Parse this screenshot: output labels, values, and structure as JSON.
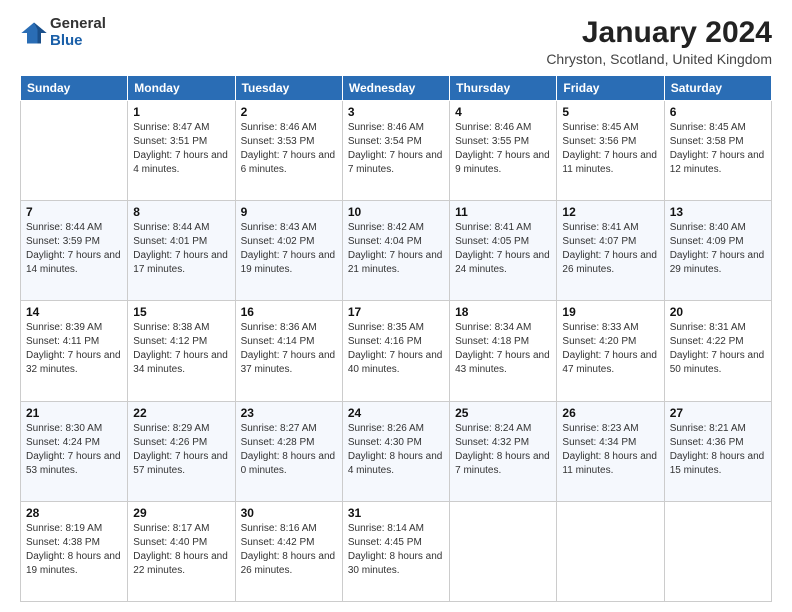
{
  "logo": {
    "general": "General",
    "blue": "Blue"
  },
  "title": "January 2024",
  "location": "Chryston, Scotland, United Kingdom",
  "days_of_week": [
    "Sunday",
    "Monday",
    "Tuesday",
    "Wednesday",
    "Thursday",
    "Friday",
    "Saturday"
  ],
  "weeks": [
    [
      {
        "day": "",
        "sunrise": "",
        "sunset": "",
        "daylight": ""
      },
      {
        "day": "1",
        "sunrise": "Sunrise: 8:47 AM",
        "sunset": "Sunset: 3:51 PM",
        "daylight": "Daylight: 7 hours and 4 minutes."
      },
      {
        "day": "2",
        "sunrise": "Sunrise: 8:46 AM",
        "sunset": "Sunset: 3:53 PM",
        "daylight": "Daylight: 7 hours and 6 minutes."
      },
      {
        "day": "3",
        "sunrise": "Sunrise: 8:46 AM",
        "sunset": "Sunset: 3:54 PM",
        "daylight": "Daylight: 7 hours and 7 minutes."
      },
      {
        "day": "4",
        "sunrise": "Sunrise: 8:46 AM",
        "sunset": "Sunset: 3:55 PM",
        "daylight": "Daylight: 7 hours and 9 minutes."
      },
      {
        "day": "5",
        "sunrise": "Sunrise: 8:45 AM",
        "sunset": "Sunset: 3:56 PM",
        "daylight": "Daylight: 7 hours and 11 minutes."
      },
      {
        "day": "6",
        "sunrise": "Sunrise: 8:45 AM",
        "sunset": "Sunset: 3:58 PM",
        "daylight": "Daylight: 7 hours and 12 minutes."
      }
    ],
    [
      {
        "day": "7",
        "sunrise": "Sunrise: 8:44 AM",
        "sunset": "Sunset: 3:59 PM",
        "daylight": "Daylight: 7 hours and 14 minutes."
      },
      {
        "day": "8",
        "sunrise": "Sunrise: 8:44 AM",
        "sunset": "Sunset: 4:01 PM",
        "daylight": "Daylight: 7 hours and 17 minutes."
      },
      {
        "day": "9",
        "sunrise": "Sunrise: 8:43 AM",
        "sunset": "Sunset: 4:02 PM",
        "daylight": "Daylight: 7 hours and 19 minutes."
      },
      {
        "day": "10",
        "sunrise": "Sunrise: 8:42 AM",
        "sunset": "Sunset: 4:04 PM",
        "daylight": "Daylight: 7 hours and 21 minutes."
      },
      {
        "day": "11",
        "sunrise": "Sunrise: 8:41 AM",
        "sunset": "Sunset: 4:05 PM",
        "daylight": "Daylight: 7 hours and 24 minutes."
      },
      {
        "day": "12",
        "sunrise": "Sunrise: 8:41 AM",
        "sunset": "Sunset: 4:07 PM",
        "daylight": "Daylight: 7 hours and 26 minutes."
      },
      {
        "day": "13",
        "sunrise": "Sunrise: 8:40 AM",
        "sunset": "Sunset: 4:09 PM",
        "daylight": "Daylight: 7 hours and 29 minutes."
      }
    ],
    [
      {
        "day": "14",
        "sunrise": "Sunrise: 8:39 AM",
        "sunset": "Sunset: 4:11 PM",
        "daylight": "Daylight: 7 hours and 32 minutes."
      },
      {
        "day": "15",
        "sunrise": "Sunrise: 8:38 AM",
        "sunset": "Sunset: 4:12 PM",
        "daylight": "Daylight: 7 hours and 34 minutes."
      },
      {
        "day": "16",
        "sunrise": "Sunrise: 8:36 AM",
        "sunset": "Sunset: 4:14 PM",
        "daylight": "Daylight: 7 hours and 37 minutes."
      },
      {
        "day": "17",
        "sunrise": "Sunrise: 8:35 AM",
        "sunset": "Sunset: 4:16 PM",
        "daylight": "Daylight: 7 hours and 40 minutes."
      },
      {
        "day": "18",
        "sunrise": "Sunrise: 8:34 AM",
        "sunset": "Sunset: 4:18 PM",
        "daylight": "Daylight: 7 hours and 43 minutes."
      },
      {
        "day": "19",
        "sunrise": "Sunrise: 8:33 AM",
        "sunset": "Sunset: 4:20 PM",
        "daylight": "Daylight: 7 hours and 47 minutes."
      },
      {
        "day": "20",
        "sunrise": "Sunrise: 8:31 AM",
        "sunset": "Sunset: 4:22 PM",
        "daylight": "Daylight: 7 hours and 50 minutes."
      }
    ],
    [
      {
        "day": "21",
        "sunrise": "Sunrise: 8:30 AM",
        "sunset": "Sunset: 4:24 PM",
        "daylight": "Daylight: 7 hours and 53 minutes."
      },
      {
        "day": "22",
        "sunrise": "Sunrise: 8:29 AM",
        "sunset": "Sunset: 4:26 PM",
        "daylight": "Daylight: 7 hours and 57 minutes."
      },
      {
        "day": "23",
        "sunrise": "Sunrise: 8:27 AM",
        "sunset": "Sunset: 4:28 PM",
        "daylight": "Daylight: 8 hours and 0 minutes."
      },
      {
        "day": "24",
        "sunrise": "Sunrise: 8:26 AM",
        "sunset": "Sunset: 4:30 PM",
        "daylight": "Daylight: 8 hours and 4 minutes."
      },
      {
        "day": "25",
        "sunrise": "Sunrise: 8:24 AM",
        "sunset": "Sunset: 4:32 PM",
        "daylight": "Daylight: 8 hours and 7 minutes."
      },
      {
        "day": "26",
        "sunrise": "Sunrise: 8:23 AM",
        "sunset": "Sunset: 4:34 PM",
        "daylight": "Daylight: 8 hours and 11 minutes."
      },
      {
        "day": "27",
        "sunrise": "Sunrise: 8:21 AM",
        "sunset": "Sunset: 4:36 PM",
        "daylight": "Daylight: 8 hours and 15 minutes."
      }
    ],
    [
      {
        "day": "28",
        "sunrise": "Sunrise: 8:19 AM",
        "sunset": "Sunset: 4:38 PM",
        "daylight": "Daylight: 8 hours and 19 minutes."
      },
      {
        "day": "29",
        "sunrise": "Sunrise: 8:17 AM",
        "sunset": "Sunset: 4:40 PM",
        "daylight": "Daylight: 8 hours and 22 minutes."
      },
      {
        "day": "30",
        "sunrise": "Sunrise: 8:16 AM",
        "sunset": "Sunset: 4:42 PM",
        "daylight": "Daylight: 8 hours and 26 minutes."
      },
      {
        "day": "31",
        "sunrise": "Sunrise: 8:14 AM",
        "sunset": "Sunset: 4:45 PM",
        "daylight": "Daylight: 8 hours and 30 minutes."
      },
      {
        "day": "",
        "sunrise": "",
        "sunset": "",
        "daylight": ""
      },
      {
        "day": "",
        "sunrise": "",
        "sunset": "",
        "daylight": ""
      },
      {
        "day": "",
        "sunrise": "",
        "sunset": "",
        "daylight": ""
      }
    ]
  ]
}
